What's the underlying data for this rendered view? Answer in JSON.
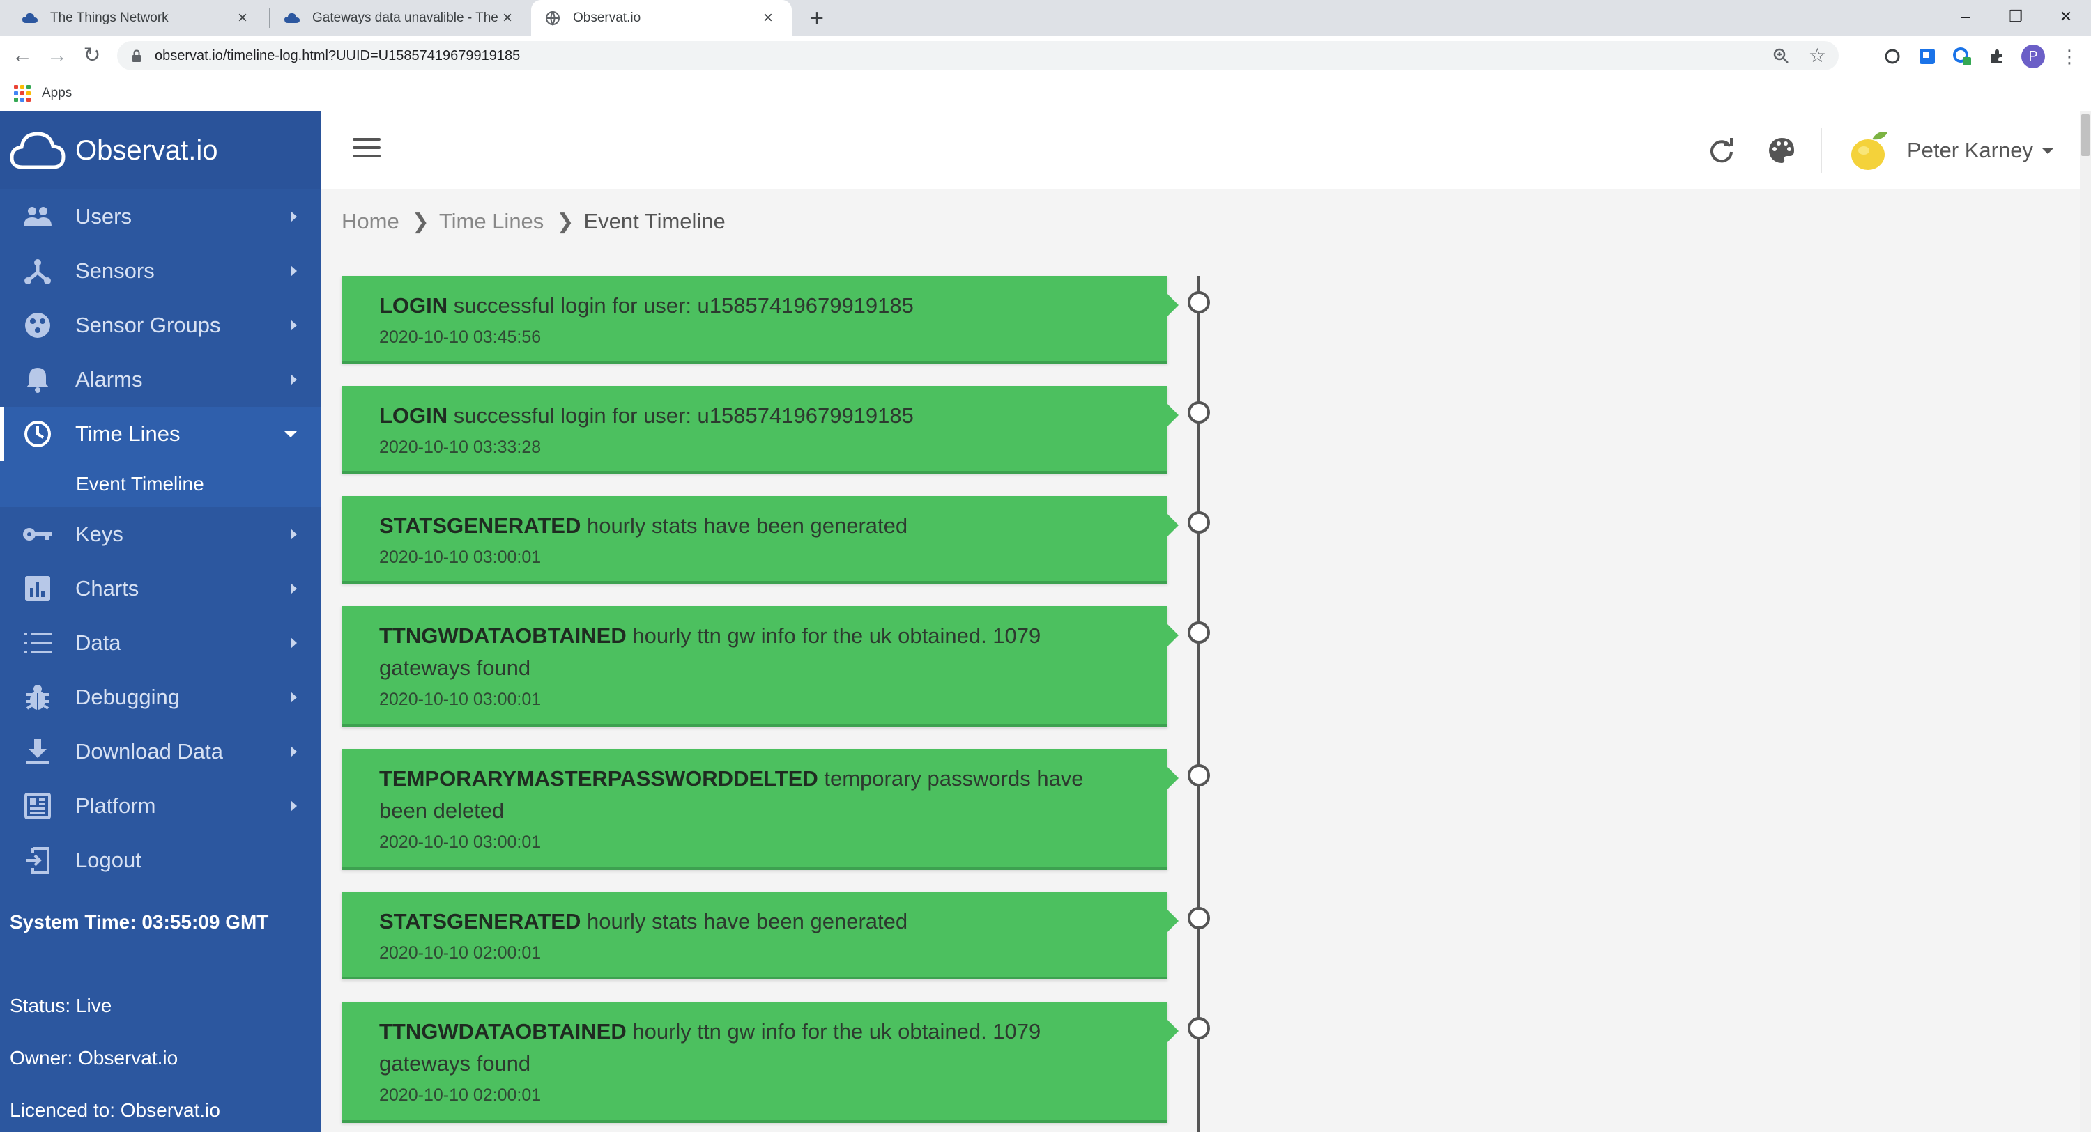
{
  "browser": {
    "tabs": [
      {
        "title": "The Things Network",
        "active": false
      },
      {
        "title": "Gateways data unavalible - The T",
        "active": false
      },
      {
        "title": "Observat.io",
        "active": true
      }
    ],
    "url": "observat.io/timeline-log.html?UUID=U15857419679919185",
    "bookmarks": {
      "apps_label": "Apps"
    },
    "profile_initial": "P"
  },
  "sidebar": {
    "brand": "Observat.io",
    "items": [
      {
        "label": "Users",
        "icon": "users-icon"
      },
      {
        "label": "Sensors",
        "icon": "sensors-icon"
      },
      {
        "label": "Sensor Groups",
        "icon": "sensor-groups-icon"
      },
      {
        "label": "Alarms",
        "icon": "bell-icon"
      },
      {
        "label": "Time Lines",
        "icon": "clock-icon",
        "active": true
      },
      {
        "label": "Keys",
        "icon": "key-icon"
      },
      {
        "label": "Charts",
        "icon": "chart-icon"
      },
      {
        "label": "Data",
        "icon": "list-icon"
      },
      {
        "label": "Debugging",
        "icon": "bug-icon"
      },
      {
        "label": "Download Data",
        "icon": "download-icon"
      },
      {
        "label": "Platform",
        "icon": "platform-icon"
      },
      {
        "label": "Logout",
        "icon": "logout-icon"
      }
    ],
    "submenu": {
      "label": "Event Timeline"
    },
    "system_time": "System Time: 03:55:09 GMT",
    "status": "Status: Live",
    "owner": "Owner: Observat.io",
    "licence": "Licenced to: Observat.io"
  },
  "topnav": {
    "user_name": "Peter Karney"
  },
  "breadcrumb": {
    "home": "Home",
    "section": "Time Lines",
    "current": "Event Timeline"
  },
  "events": [
    {
      "type": "LOGIN",
      "message": " successful login for user: u15857419679919185",
      "timestamp": "2020-10-10 03:45:56"
    },
    {
      "type": "LOGIN",
      "message": " successful login for user: u15857419679919185",
      "timestamp": "2020-10-10 03:33:28"
    },
    {
      "type": "STATSGENERATED",
      "message": " hourly stats have been generated",
      "timestamp": "2020-10-10 03:00:01"
    },
    {
      "type": "TTNGWDATAOBTAINED",
      "message": " hourly ttn gw info for the uk obtained. 1079 gateways found",
      "timestamp": "2020-10-10 03:00:01"
    },
    {
      "type": "TEMPORARYMASTERPASSWORDDELTED",
      "message": " temporary passwords have been deleted",
      "timestamp": "2020-10-10 03:00:01"
    },
    {
      "type": "STATSGENERATED",
      "message": " hourly stats have been generated",
      "timestamp": "2020-10-10 02:00:01"
    },
    {
      "type": "TTNGWDATAOBTAINED",
      "message": " hourly ttn gw info for the uk obtained. 1079 gateways found",
      "timestamp": "2020-10-10 02:00:01"
    }
  ],
  "colors": {
    "sidebar": "#2c579f",
    "event_green": "#4cc05f",
    "timeline": "#555555"
  }
}
